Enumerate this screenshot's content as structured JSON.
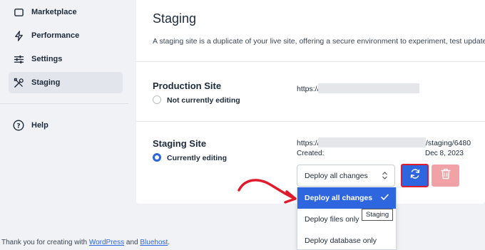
{
  "sidebar": {
    "items": [
      {
        "label": "Marketplace",
        "icon": "marketplace-icon"
      },
      {
        "label": "Performance",
        "icon": "bolt-icon"
      },
      {
        "label": "Settings",
        "icon": "sliders-icon"
      },
      {
        "label": "Staging",
        "icon": "tools-icon",
        "active": true
      },
      {
        "label": "Help",
        "icon": "help-icon"
      }
    ]
  },
  "main": {
    "title": "Staging",
    "description": "A staging site is a duplicate of your live site, offering a secure environment to experiment, test updates, and dep",
    "production": {
      "title": "Production Site",
      "status": "Not currently editing",
      "url_prefix": "https://"
    },
    "staging": {
      "title": "Staging Site",
      "status": "Currently editing",
      "url_prefix": "https://",
      "url_suffix": "/staging/6480",
      "created_label": "Created:",
      "created_date": "Dec 8, 2023"
    },
    "deploy": {
      "selected": "Deploy all changes",
      "options": [
        "Deploy all changes",
        "Deploy files only",
        "Deploy database only"
      ],
      "tooltip": "Staging"
    }
  },
  "footer": {
    "prefix": "Thank you for creating with ",
    "link1": "WordPress",
    "middle": " and ",
    "link2": "Bluehost",
    "suffix": "."
  },
  "colors": {
    "accent": "#2e66e0",
    "danger_light": "#f0a2a6",
    "highlight_border": "#e01c2c",
    "annotation_arrow": "#e01c2c"
  }
}
